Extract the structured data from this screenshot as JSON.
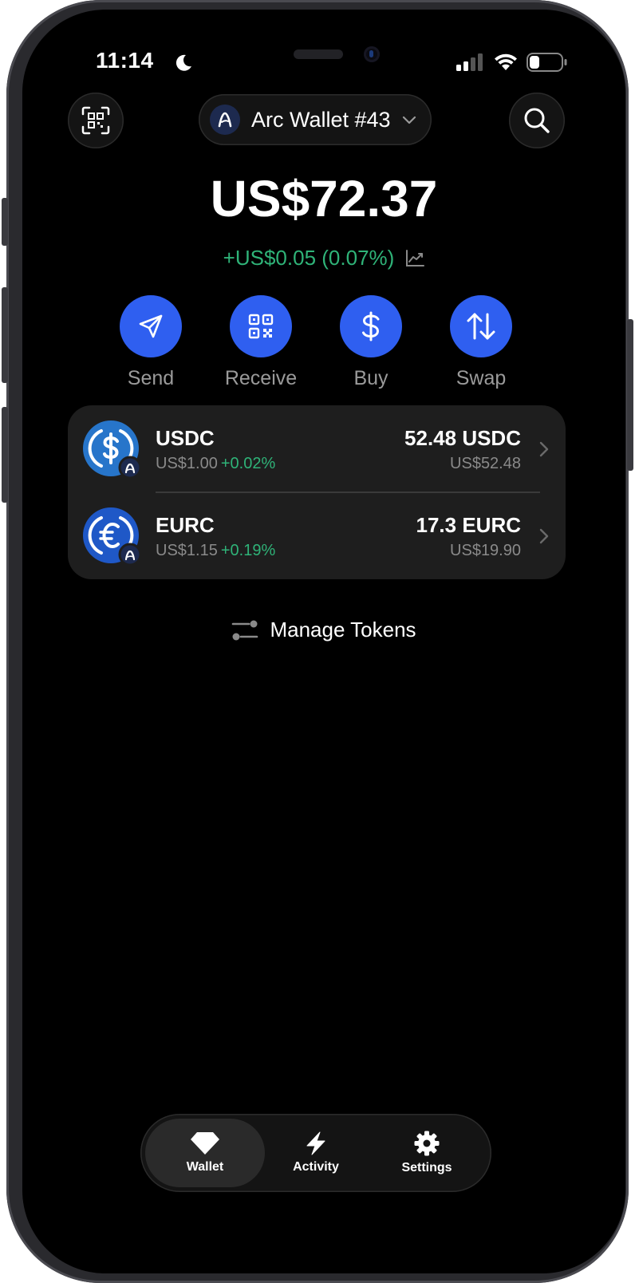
{
  "status_bar": {
    "time": "11:14"
  },
  "header": {
    "wallet_name": "Arc Wallet #43"
  },
  "portfolio": {
    "balance": "US$72.37",
    "change": "+US$0.05 (0.07%)"
  },
  "actions": [
    {
      "label": "Send",
      "icon": "send-icon"
    },
    {
      "label": "Receive",
      "icon": "qr-code-icon"
    },
    {
      "label": "Buy",
      "icon": "dollar-icon"
    },
    {
      "label": "Swap",
      "icon": "swap-arrows-icon"
    }
  ],
  "tokens": [
    {
      "symbol": "USDC",
      "price": "US$1.00",
      "change": "+0.02%",
      "amount": "52.48 USDC",
      "fiat": "US$52.48"
    },
    {
      "symbol": "EURC",
      "price": "US$1.15",
      "change": "+0.19%",
      "amount": "17.3 EURC",
      "fiat": "US$19.90"
    }
  ],
  "manage_tokens_label": "Manage Tokens",
  "tabs": [
    {
      "label": "Wallet",
      "active": true
    },
    {
      "label": "Activity",
      "active": false
    },
    {
      "label": "Settings",
      "active": false
    }
  ],
  "colors": {
    "accent_blue": "#2f5ff0",
    "positive_green": "#2fb378",
    "background": "#000000",
    "card": "#1e1e1e"
  }
}
